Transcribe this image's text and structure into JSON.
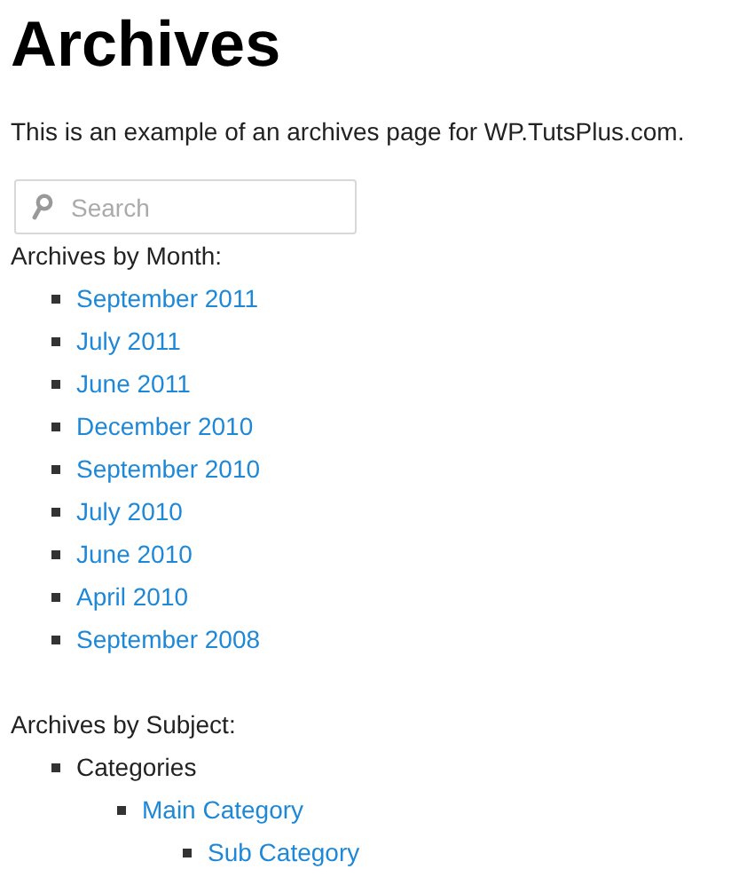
{
  "title": "Archives",
  "intro": "This is an example of an archives page for WP.TutsPlus.com.",
  "search": {
    "placeholder": "Search"
  },
  "months": {
    "heading": "Archives by Month:",
    "items": [
      {
        "label": "September 2011"
      },
      {
        "label": "July 2011"
      },
      {
        "label": "June 2011"
      },
      {
        "label": "December 2010"
      },
      {
        "label": "September 2010"
      },
      {
        "label": "July 2010"
      },
      {
        "label": "June 2010"
      },
      {
        "label": "April 2010"
      },
      {
        "label": "September 2008"
      }
    ]
  },
  "subjects": {
    "heading": "Archives by Subject:",
    "items": [
      {
        "label": "Categories",
        "kind": "text",
        "children": [
          {
            "label": "Main Category",
            "kind": "link",
            "children": [
              {
                "label": "Sub Category",
                "kind": "link"
              }
            ]
          }
        ]
      }
    ]
  }
}
